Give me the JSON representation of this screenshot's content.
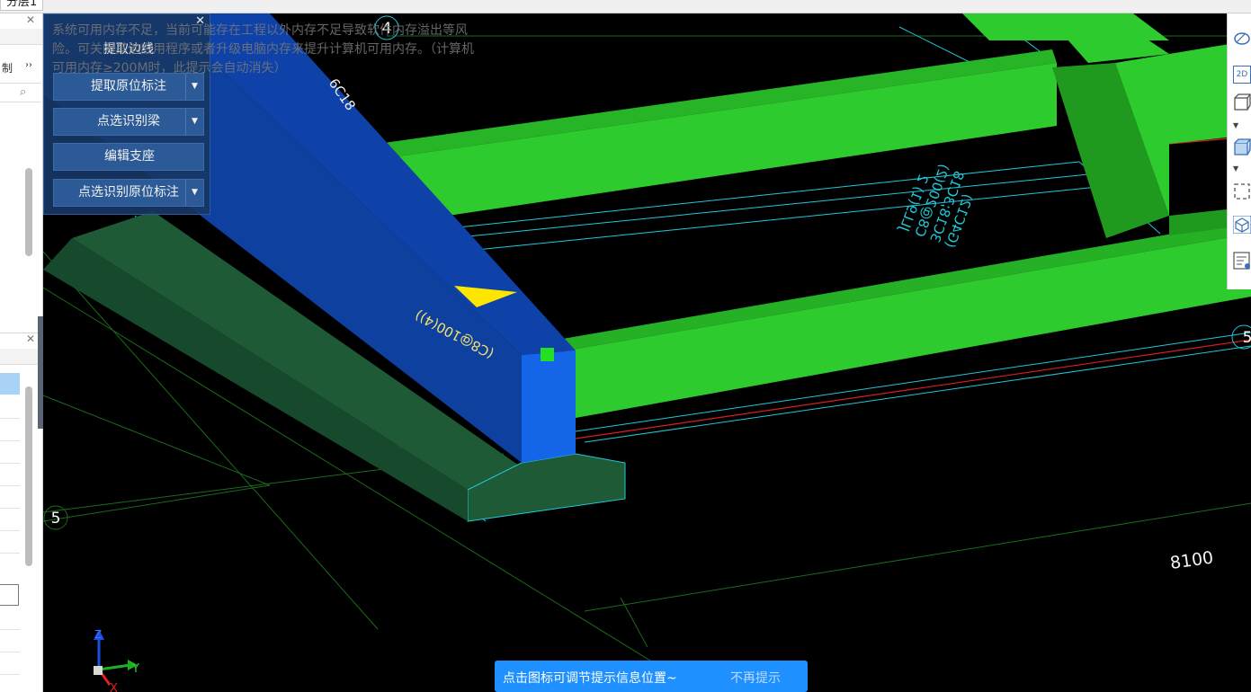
{
  "floor_tab": "分层1",
  "left_dock": {
    "pane1_label": "制",
    "pane1_expand": "››",
    "close_glyph": "✕"
  },
  "floating_panel": {
    "close_glyph": "✕",
    "buttons": [
      {
        "label": "提取边线",
        "dropdown": false
      },
      {
        "label": "提取原位标注",
        "dropdown": true
      },
      {
        "label": "点选识别梁",
        "dropdown": true
      },
      {
        "label": "编辑支座",
        "dropdown": false
      },
      {
        "label": "点选识别原位标注",
        "dropdown": true
      }
    ]
  },
  "memory_warning": "系统可用内存不足，当前可能存在工程以外内存不足导致软件内存溢出等风险。可关闭其他应用程序或者升级电脑内存来提升计算机可用内存。（计算机可用内存≥200M时，此提示会自动消失）",
  "viewport": {
    "axis_labels": [
      "4",
      "5"
    ],
    "beam_annotations": [
      "6C18",
      "(C8@100(4))",
      "JLL9(1) 2",
      "C8@200(2)",
      "3C18;3C18",
      "(G4C12)"
    ],
    "dimension": "8100",
    "coordinate_axes": {
      "z": "Z",
      "y": "Y",
      "x": "X"
    },
    "colors": {
      "selected_beam": "#0e42a8",
      "beam": "#2ecb2e",
      "footing": "#1f5a36",
      "grid": "#20c8d8"
    }
  },
  "right_toolbar": {
    "icons": [
      "orbit-icon",
      "2d-view-icon",
      "3d-box-icon",
      "chevron-down-icon",
      "solid-box-icon",
      "chevron-down-icon",
      "select-region-icon",
      "3d-cube-icon",
      "properties-list-icon"
    ],
    "label_2d": "2D"
  },
  "hint_bar": {
    "text": "点击图标可调节提示信息位置~",
    "dismiss": "不再提示"
  }
}
